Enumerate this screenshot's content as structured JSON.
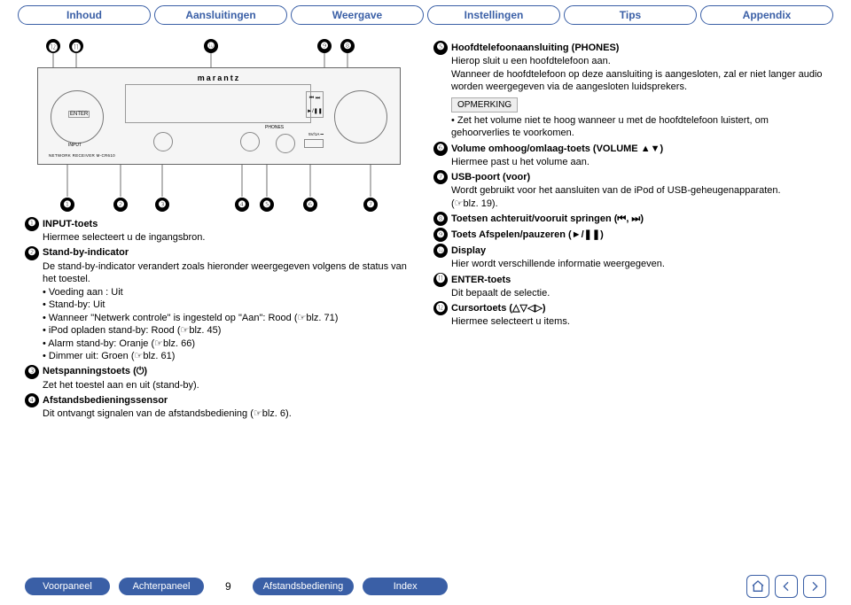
{
  "tabs": [
    "Inhoud",
    "Aansluitingen",
    "Weergave",
    "Instellingen",
    "Tips",
    "Appendix"
  ],
  "diagram": {
    "brand": "marantz",
    "enter": "ENTER",
    "input_lbl": "INPUT",
    "network_lbl": "NETWORK RECEIVER M-CR610",
    "phones_lbl": "PHONES",
    "usb_lbl": "5V/1A ⎓",
    "top_callouts": [
      "⓬",
      "⓫",
      "❿",
      "❾",
      "❽"
    ],
    "bottom_callouts": [
      "❶",
      "❷",
      "❸",
      "❹",
      "❺",
      "❻",
      "❼"
    ]
  },
  "left_items": [
    {
      "n": "❶",
      "title": "INPUT-toets",
      "lines": [
        "Hiermee selecteert u de ingangsbron."
      ]
    },
    {
      "n": "❷",
      "title": "Stand-by-indicator",
      "lines": [
        "De stand-by-indicator verandert zoals hieronder weergegeven volgens de status van het toestel.",
        "• Voeding aan : Uit",
        "• Stand-by: Uit",
        "• Wanneer \"Netwerk controle\" is ingesteld op \"Aan\": Rood (☞blz. 71)",
        "• iPod opladen stand-by: Rood (☞blz. 45)",
        "• Alarm stand-by: Oranje (☞blz. 66)",
        "• Dimmer uit: Groen (☞blz. 61)"
      ]
    },
    {
      "n": "❸",
      "title": "Netspanningstoets (⏻)",
      "lines": [
        "Zet het toestel aan en uit (stand-by)."
      ]
    },
    {
      "n": "❹",
      "title": "Afstandsbedieningssensor",
      "lines": [
        "Dit ontvangt signalen van de afstandsbediening (☞blz. 6)."
      ]
    }
  ],
  "right_items": [
    {
      "n": "❺",
      "title": "Hoofdtelefoonaansluiting (PHONES)",
      "lines": [
        "Hierop sluit u een hoofdtelefoon aan.",
        "Wanneer de hoofdtelefoon op deze aansluiting is aangesloten, zal er niet langer audio worden weergegeven via de aangesloten luidsprekers."
      ],
      "note_label": "OPMERKING",
      "note": "• Zet het volume niet te hoog wanneer u met de hoofdtelefoon luistert, om gehoorverlies te voorkomen."
    },
    {
      "n": "❻",
      "title": "Volume omhoog/omlaag-toets (VOLUME ▲▼)",
      "lines": [
        "Hiermee past u het volume aan."
      ]
    },
    {
      "n": "❼",
      "title": "USB-poort (voor)",
      "lines": [
        "Wordt gebruikt voor het aansluiten van de iPod of USB-geheugenapparaten.",
        "(☞blz. 19)."
      ]
    },
    {
      "n": "❽",
      "title": "Toetsen achteruit/vooruit springen (⏮, ⏭)",
      "lines": []
    },
    {
      "n": "❾",
      "title": "Toets Afspelen/pauzeren (►/❚❚)",
      "lines": []
    },
    {
      "n": "❿",
      "title": "Display",
      "lines": [
        "Hier wordt verschillende informatie weergegeven."
      ]
    },
    {
      "n": "⓫",
      "title": "ENTER-toets",
      "lines": [
        "Dit bepaalt de selectie."
      ]
    },
    {
      "n": "⓬",
      "title": "Cursortoets (△▽◁▷)",
      "lines": [
        "Hiermee selecteert u items."
      ]
    }
  ],
  "footer": {
    "buttons": [
      "Voorpaneel",
      "Achterpaneel",
      "Afstandsbediening",
      "Index"
    ],
    "page": "9"
  }
}
